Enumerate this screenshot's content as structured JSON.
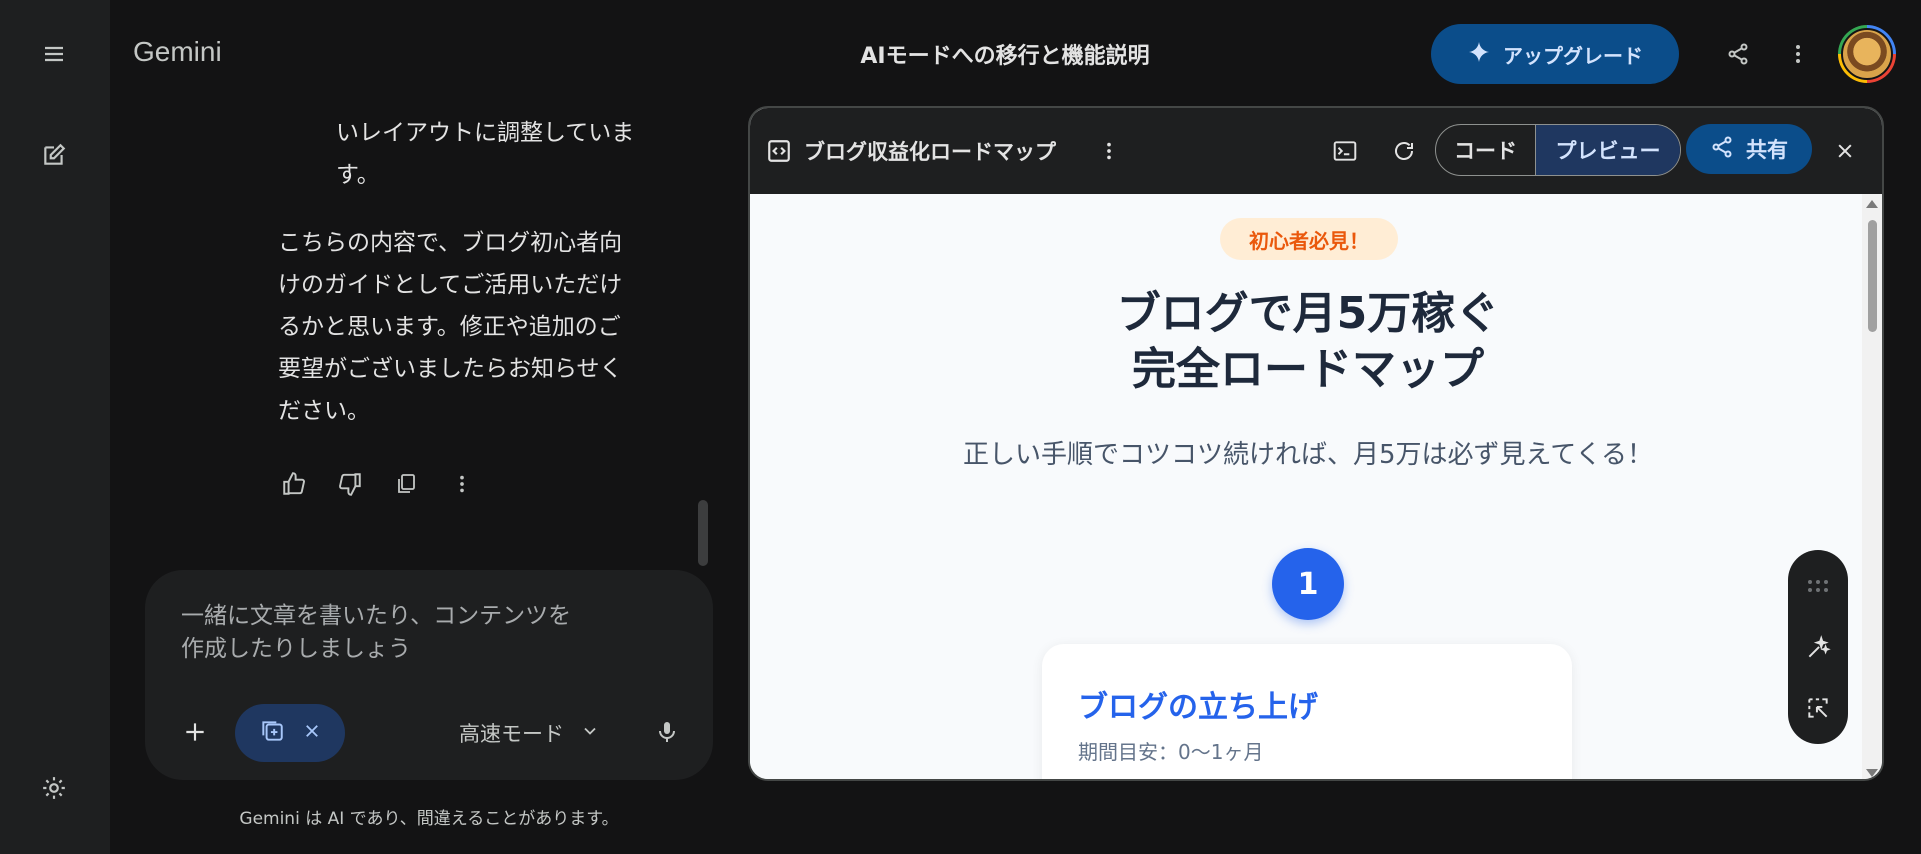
{
  "app": {
    "brand": "Gemini",
    "conversation_title": "AIモードへの移行と機能説明",
    "upgrade_label": "アップグレード"
  },
  "rail": {
    "icons": [
      "menu-icon",
      "new-chat-icon",
      "settings-icon"
    ]
  },
  "chat": {
    "partial_line_1": "いレイアウトに調整していま",
    "partial_line_2": "す。",
    "paragraph_lines": [
      "こちらの内容で、ブログ初心者向",
      "けのガイドとしてご活用いただけ",
      "るかと思います。修正や追加のご",
      "要望がございましたらお知らせく",
      "ださい。"
    ]
  },
  "composer": {
    "placeholder_line_1": "一緒に文章を書いたり、コンテンツを",
    "placeholder_line_2": "作成したりしましょう",
    "mode_label": "高速モード"
  },
  "disclaimer": "Gemini は AI であり、間違えることがあります。",
  "canvas": {
    "title": "ブログ収益化ロードマップ",
    "tab_code": "コード",
    "tab_preview": "プレビュー",
    "share_label": "共有"
  },
  "preview": {
    "badge": "初心者必見！",
    "heading_line_1": "ブログで月5万稼ぐ",
    "heading_line_2": "完全ロードマップ",
    "subtitle": "正しい手順でコツコツ続ければ、月5万は必ず見えてくる！",
    "step_number": "1",
    "card_title": "ブログの立ち上げ",
    "card_meta": "期間目安：0〜1ヶ月"
  },
  "colors": {
    "accent": "#2563eb",
    "badge_text": "#ea580c",
    "upgrade_bg": "#0b4d8a"
  }
}
